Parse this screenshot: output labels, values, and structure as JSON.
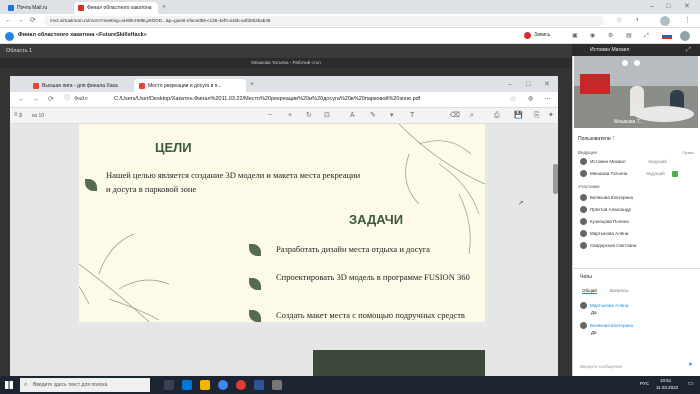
{
  "outer_tabs": [
    {
      "label": "Почта Mail.ru",
      "color": "#1a73e8"
    },
    {
      "label": "Финал областного хакатона",
      "color": "#d93025"
    },
    {
      "label": "",
      "color": "#ffffff"
    }
  ],
  "outer_url": "mv2.virtualroom.ru/room?meeting=aH80cHM6Ly9OOD...&p=guest-efaced59-c136-4ef0-a18b-a4fd052bab48",
  "app_title": "Финал областного хакатона «FutureSkillsHack»",
  "app_actions": {
    "record": "Запись"
  },
  "area_label": "Область 1",
  "share_title": "Мешкова Татьяна - Рабочий стол",
  "inner_tabs": [
    {
      "label": "Высшая лига - для финала Хака",
      "color": "#ea4335"
    },
    {
      "label": "Место рекреации и досуга в п...",
      "color": "#ea4335"
    }
  ],
  "file_label": "Файл",
  "pdf_path": "C:/Users/User/Desktop/Хакатон.Финал%2011.03.22/Место%20рекреации%20и%20досуга%20в%20парковой%20зоне.pdf",
  "page_current": "3",
  "page_total": "из 10",
  "slide": {
    "goals_heading": "ЦЕЛИ",
    "goals_text": "Нашей целью является создание 3D модели и макета места рекреации и досуга в парковой зоне",
    "tasks_heading": "ЗАДАЧИ",
    "tasks": [
      "Разработать дизайн места отдыха и досуга",
      "Спроектировать 3D модель в программе FUSION 360",
      "Создать макет места с помощью подручных средств"
    ]
  },
  "right_panel": {
    "video_title": "Истомин Михаил",
    "video_caption": "Мешкова Т...",
    "participants_label": "Пользователи",
    "participants_count": "7",
    "rights_label": "Права",
    "moderators_label": "Ведущие",
    "moderators": [
      {
        "name": "Истомин Михаил",
        "role": "ведущий"
      },
      {
        "name": "Мешкова Татьяна",
        "role": "ведущий"
      }
    ],
    "members_label": "Участники",
    "members": [
      "Белякова Екатерина",
      "Пряхтов Александр",
      "Кузнецова Полина",
      "Мартынова Алёна",
      "Свидерская Светлана"
    ],
    "chat_label": "Чаты",
    "chat_tabs": [
      "Общий",
      "Вопросы"
    ],
    "messages": [
      {
        "author": "Мартынова Алёна",
        "text": "Да"
      },
      {
        "author": "Белякова Екатерина",
        "text": "Да"
      }
    ],
    "chat_placeholder": "Введите сообщение"
  },
  "taskbar": {
    "search_placeholder": "Введите здесь текст для поиска",
    "lang": "РУС",
    "time": "10:51",
    "date": "11.03.2022"
  }
}
